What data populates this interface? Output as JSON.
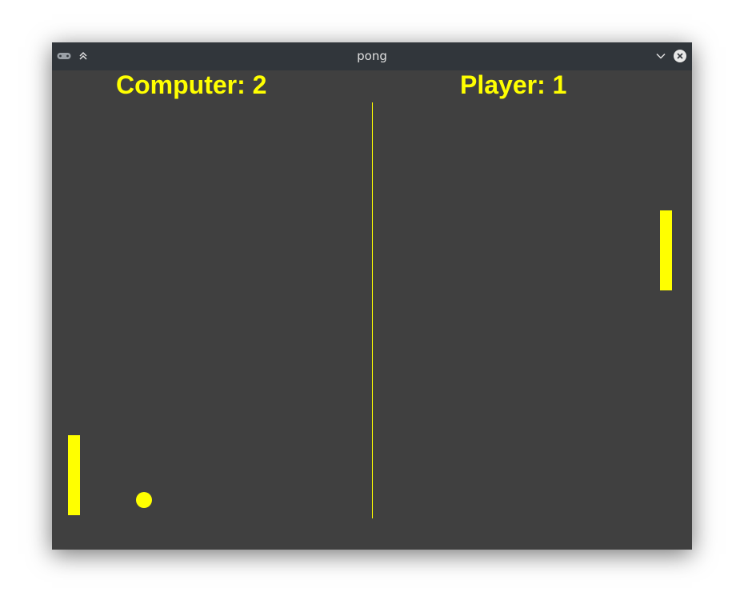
{
  "window": {
    "title": "pong"
  },
  "titlebar": {
    "left_icons": [
      "gamepad-icon",
      "keep-above-icon"
    ],
    "right_icons": [
      "chevron-down-icon",
      "close-icon"
    ]
  },
  "scoreboard": {
    "computer": "Computer: 2",
    "player": "Player: 1"
  },
  "colors": {
    "field_background": "#404040",
    "foreground": "#ffff00",
    "titlebar": "#31363b"
  }
}
